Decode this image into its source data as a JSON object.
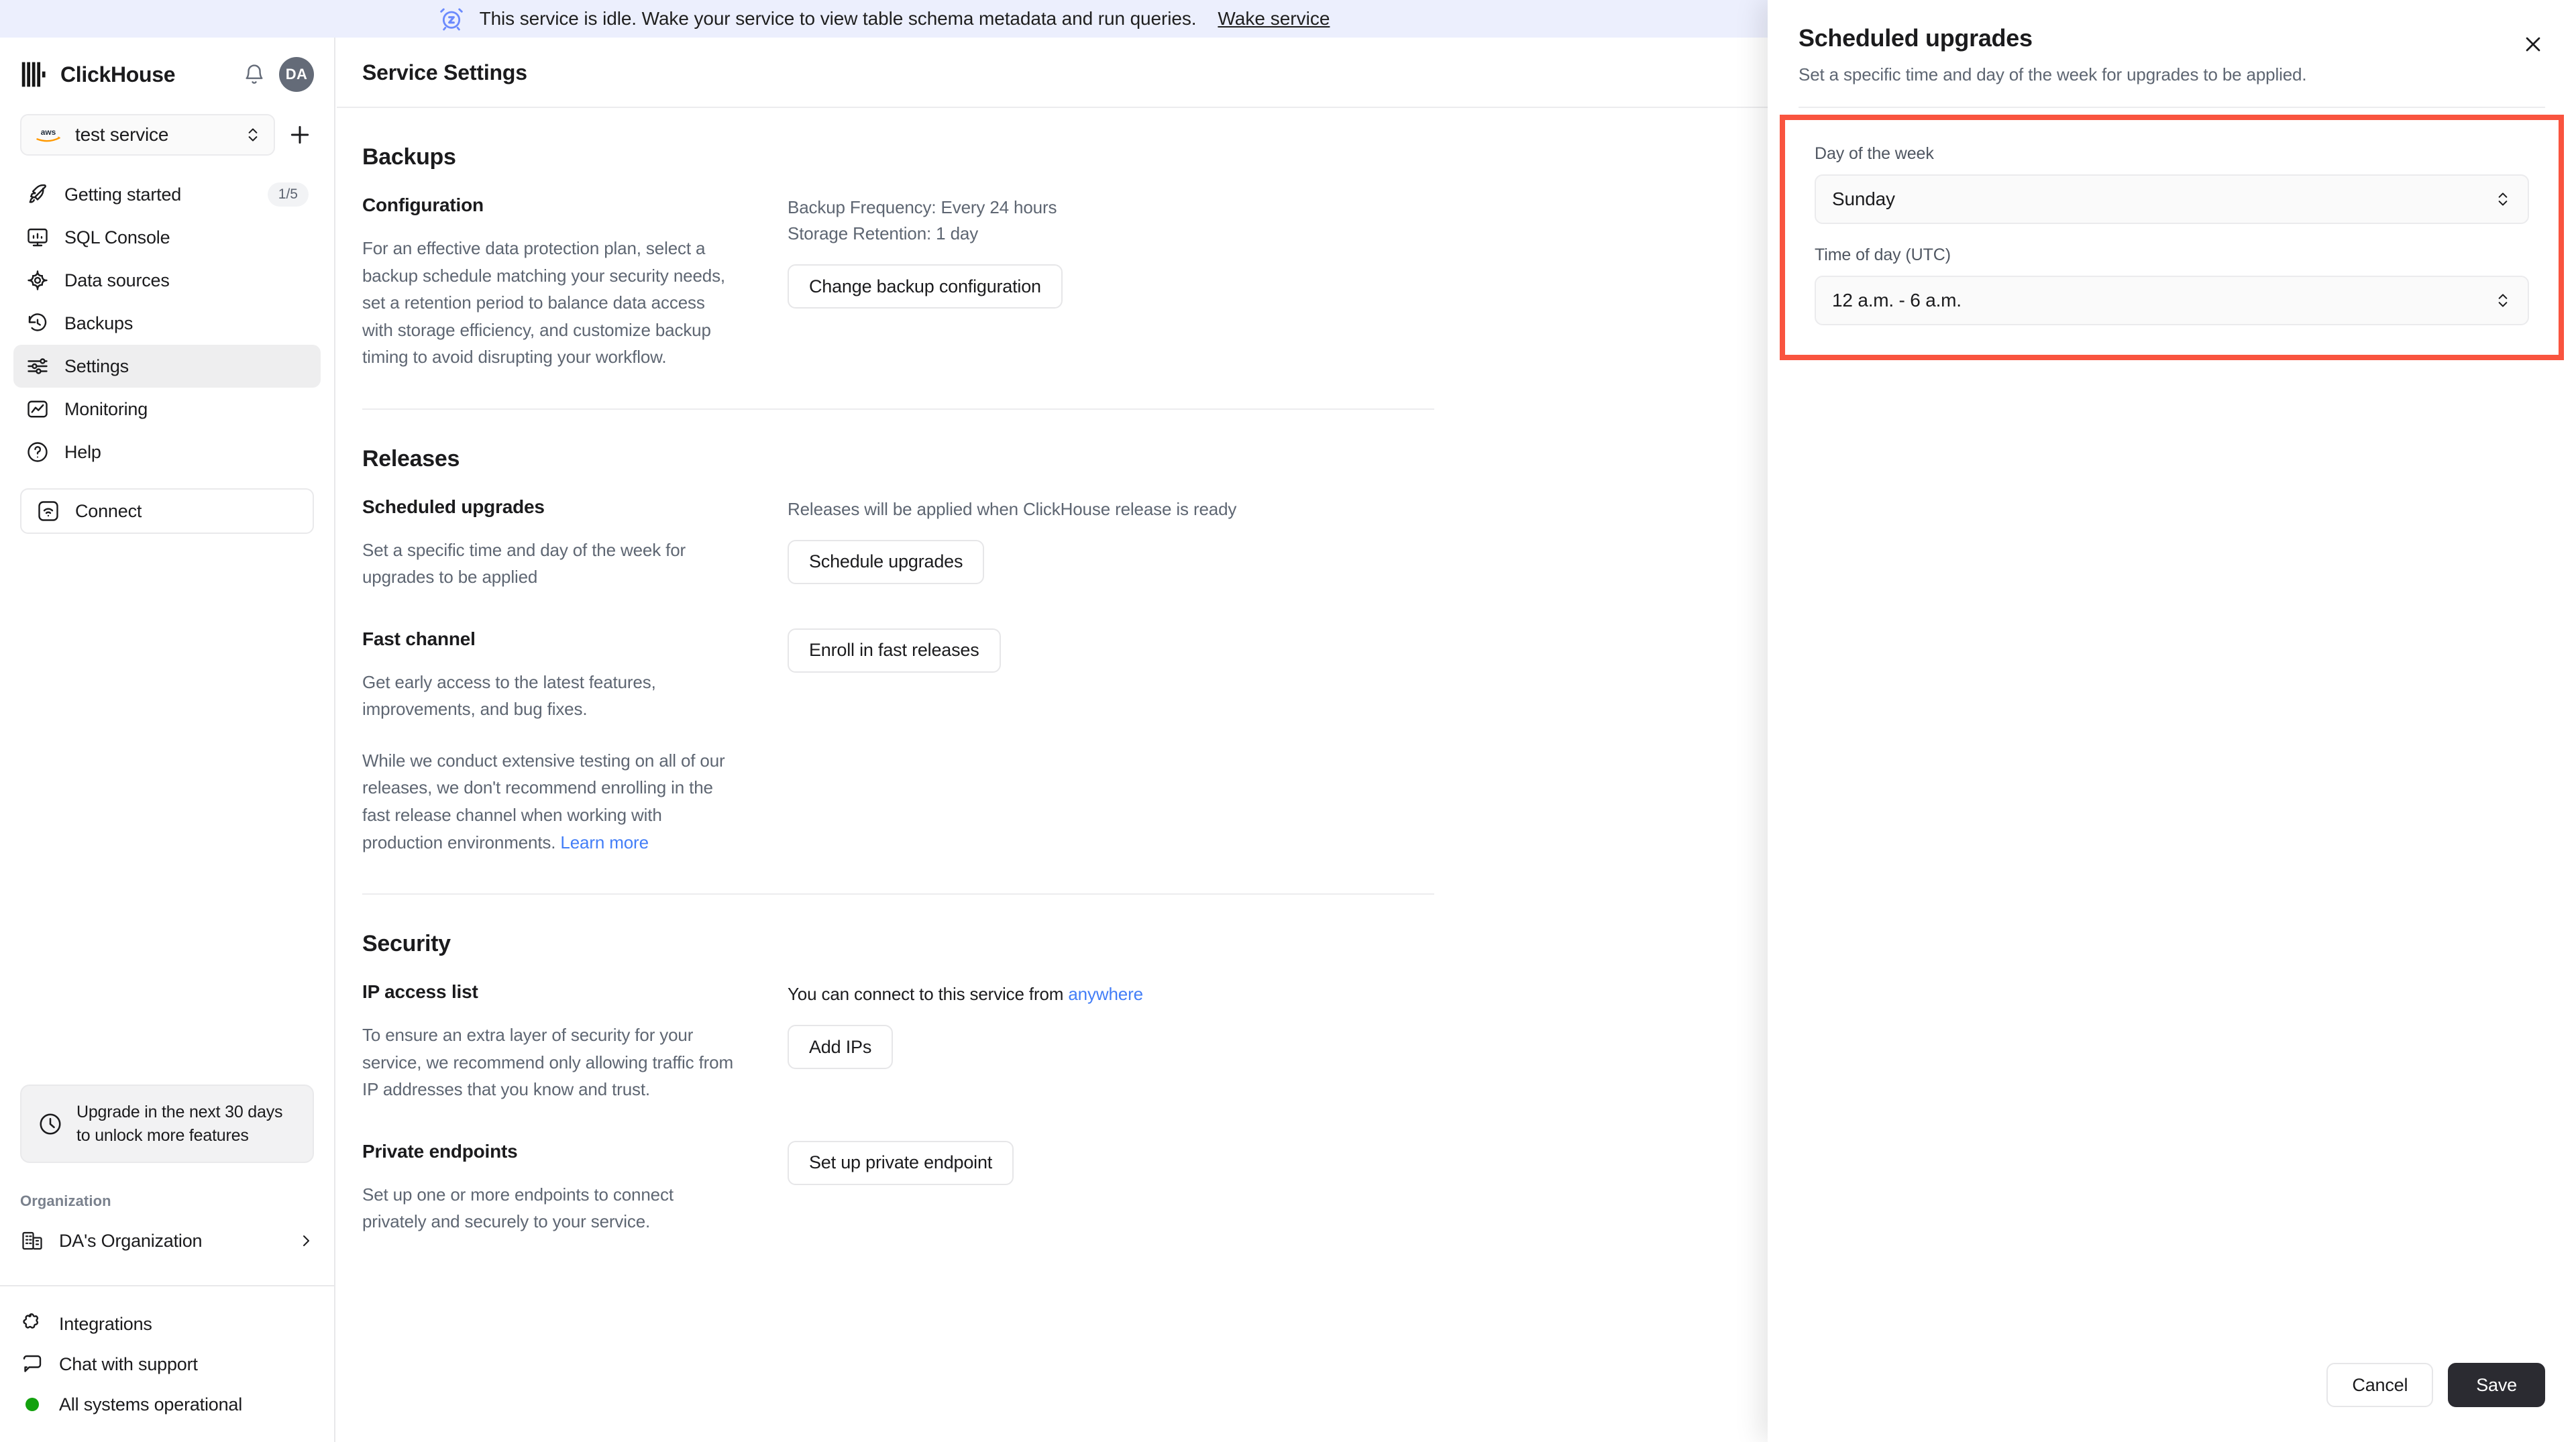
{
  "banner": {
    "icon": "alarm-snooze-icon",
    "text": "This service is idle. Wake your service to view table schema metadata and run queries.",
    "link": "Wake service",
    "bg": "#eceffd"
  },
  "sidebar": {
    "brand": "ClickHouse",
    "avatar_initials": "DA",
    "service": {
      "cloud": "aws",
      "name": "test service"
    },
    "nav": [
      {
        "label": "Getting started",
        "icon": "rocket-icon",
        "badge": "1/5",
        "active": false
      },
      {
        "label": "SQL Console",
        "icon": "console-icon",
        "badge": "",
        "active": false
      },
      {
        "label": "Data sources",
        "icon": "data-sources-icon",
        "badge": "",
        "active": false
      },
      {
        "label": "Backups",
        "icon": "backup-restore-icon",
        "badge": "",
        "active": false
      },
      {
        "label": "Settings",
        "icon": "sliders-icon",
        "badge": "",
        "active": true
      },
      {
        "label": "Monitoring",
        "icon": "chart-icon",
        "badge": "",
        "active": false
      },
      {
        "label": "Help",
        "icon": "question-circle-icon",
        "badge": "",
        "active": false
      }
    ],
    "connect": {
      "label": "Connect",
      "icon": "wifi-icon"
    },
    "upgrade": {
      "icon": "clock-icon",
      "text": "Upgrade in the next 30 days to unlock more features"
    },
    "organization": {
      "label": "Organization",
      "name": "DA's Organization",
      "icon": "building-icon"
    },
    "footer": [
      {
        "label": "Integrations",
        "icon": "puzzle-icon"
      },
      {
        "label": "Chat with support",
        "icon": "chat-bubble-icon"
      },
      {
        "label": "All systems operational",
        "icon": "status-dot-icon",
        "color": "#13a10e"
      }
    ]
  },
  "main": {
    "page_title": "Service Settings",
    "sections": [
      {
        "title": "Backups",
        "rows": [
          {
            "heading": "Configuration",
            "desc": "For an effective data protection plan, select a backup schedule matching your security needs, set a retention period to balance data access with storage efficiency, and customize backup timing to avoid disrupting your workflow.",
            "info_lines": [
              "Backup Frequency: Every 24 hours",
              "Storage Retention: 1 day"
            ],
            "button": "Change backup configuration"
          }
        ]
      },
      {
        "title": "Releases",
        "rows": [
          {
            "heading": "Scheduled upgrades",
            "desc": "Set a specific time and day of the week for upgrades to be applied",
            "info_lines": [
              "Releases will be applied when ClickHouse release is ready"
            ],
            "button": "Schedule upgrades"
          },
          {
            "heading": "Fast channel",
            "desc": "Get early access to the latest features, improvements, and bug fixes.",
            "desc2_pre": "While we conduct extensive testing on all of our releases, we don't recommend enrolling in the fast release channel when working with production environments. ",
            "desc2_link": "Learn more",
            "button": "Enroll in fast releases"
          }
        ]
      },
      {
        "title": "Security",
        "rows": [
          {
            "heading": "IP access list",
            "desc": "To ensure an extra layer of security for your service, we recommend only allowing traffic from IP addresses that you know and trust.",
            "info_pre": "You can connect to this service from ",
            "info_link": "anywhere",
            "button": "Add IPs"
          },
          {
            "heading": "Private endpoints",
            "desc": "Set up one or more endpoints to connect privately and securely to your service.",
            "button": "Set up private endpoint"
          }
        ]
      }
    ]
  },
  "drawer": {
    "title": "Scheduled upgrades",
    "subtitle": "Set a specific time and day of the week for upgrades to be applied.",
    "close_icon": "close-icon",
    "highlight_color": "#f9543f",
    "fields": [
      {
        "label": "Day of the week",
        "value": "Sunday"
      },
      {
        "label": "Time of day (UTC)",
        "value": "12 a.m. - 6 a.m."
      }
    ],
    "cancel_label": "Cancel",
    "save_label": "Save"
  }
}
